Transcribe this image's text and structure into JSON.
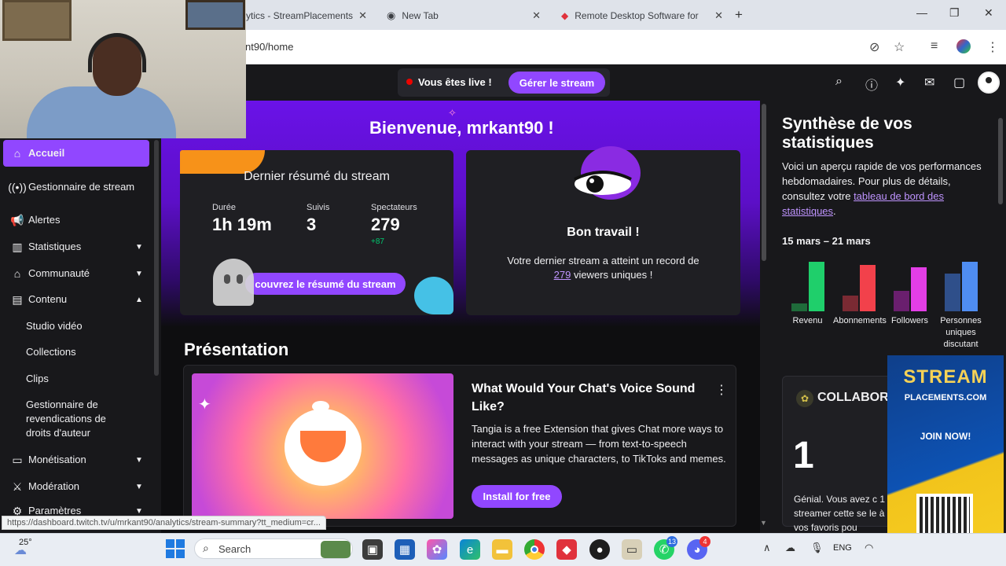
{
  "browser": {
    "tabs": [
      {
        "label": "ytics - StreamPlacements",
        "close": "✕"
      },
      {
        "label": "New Tab",
        "close": "✕"
      },
      {
        "label": "Remote Desktop Software for W",
        "close": "✕"
      }
    ],
    "new_tab": "+",
    "window_controls": {
      "minimize": "—",
      "restore": "❐",
      "close": "✕"
    },
    "url": "nt90/home",
    "toolbar_icons": [
      "eye-off-icon",
      "star-icon",
      "media-icon",
      "profile-icon",
      "more-icon"
    ]
  },
  "topbar": {
    "live_text": "Vous êtes live !",
    "manage_button": "Gérer le stream",
    "icons": [
      "search-icon",
      "help-icon",
      "sparkle-icon",
      "mail-icon",
      "chat-icon"
    ]
  },
  "sidebar": {
    "items": [
      {
        "label": "Accueil",
        "icon": "home-icon",
        "active": true
      },
      {
        "label": "Gestionnaire de stream",
        "icon": "broadcast-icon"
      },
      {
        "label": "Alertes",
        "icon": "megaphone-icon"
      },
      {
        "label": "Statistiques",
        "icon": "chart-icon",
        "chevron": "down"
      },
      {
        "label": "Communauté",
        "icon": "community-icon",
        "chevron": "down"
      },
      {
        "label": "Contenu",
        "icon": "content-icon",
        "chevron": "up"
      },
      {
        "label": "Studio vidéo"
      },
      {
        "label": "Collections"
      },
      {
        "label": "Clips"
      },
      {
        "label": "Gestionnaire de revendications de droits d'auteur"
      },
      {
        "label": "Monétisation",
        "icon": "money-icon",
        "chevron": "down"
      },
      {
        "label": "Modération",
        "icon": "sword-icon",
        "chevron": "down"
      },
      {
        "label": "Paramètres",
        "icon": "settings-icon",
        "chevron": "down"
      }
    ]
  },
  "main": {
    "welcome": "Bienvenue, mrkant90 !",
    "summary_card": {
      "title": "Dernier résumé du stream",
      "stats": [
        {
          "label": "Durée",
          "value": "1h 19m"
        },
        {
          "label": "Suivis",
          "value": "3"
        },
        {
          "label": "Spectateurs",
          "value": "279",
          "delta": "+87"
        }
      ],
      "button": "Découvrez le résumé du stream",
      "button_visible": "couvrez le résumé du stream"
    },
    "record_card": {
      "title": "Bon travail !",
      "text_before": "Votre dernier stream a atteint un record de",
      "link": "279",
      "text_after": "viewers uniques !"
    },
    "presentation": {
      "title": "Présentation",
      "promo_title": "What Would Your Chat's Voice Sound Like?",
      "promo_desc": "Tangia is a free Extension that gives Chat more ways to interact with your stream — from text-to-speech messages as unique characters, to TikToks and memes.",
      "install_button": "Install for free",
      "more": "⋮"
    }
  },
  "stats_panel": {
    "title": "Synthèse de vos statistiques",
    "desc_before": "Voici un aperçu rapide de vos performances hebdomadaires. Pour plus de détails, consultez votre",
    "desc_link": "tableau de bord des statistiques",
    "desc_after": ".",
    "date_range": "15 mars – 21 mars",
    "chart_data": {
      "type": "bar",
      "categories": [
        "Revenu",
        "Abonnements",
        "Followers",
        "Personnes uniques discutant"
      ],
      "series": [
        {
          "values": [
            0.15,
            0.3,
            0.4,
            0.72
          ]
        },
        {
          "values": [
            0.95,
            0.9,
            0.85,
            0.95
          ]
        }
      ],
      "colors": [
        [
          "#1f6b3a",
          "#1fcf6b"
        ],
        [
          "#7a2a33",
          "#f2414b"
        ],
        [
          "#6a1f6e",
          "#e33ee6"
        ],
        [
          "#2f4f8a",
          "#4f8df2"
        ]
      ]
    }
  },
  "collab": {
    "title": "COLLABOR",
    "number": "1",
    "text": "Génial. Vous avez c 1 streamer cette se le à vos favoris pou"
  },
  "ad": {
    "title": "STREAM",
    "subtitle": "PLACEMENTS.COM",
    "cta": "JOIN NOW!"
  },
  "status_url": "https://dashboard.twitch.tv/u/mrkant90/analytics/stream-summary?tt_medium=cr...",
  "taskbar": {
    "weather": "25°",
    "search_placeholder": "Search",
    "whatsapp_badge": "13",
    "discord_badge": "4",
    "lang": "ENG"
  }
}
